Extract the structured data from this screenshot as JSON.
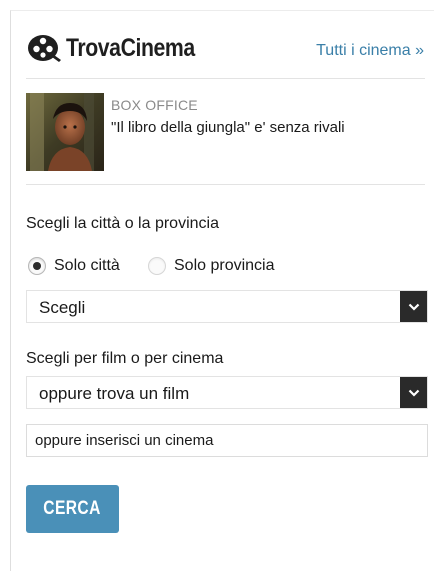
{
  "header": {
    "logo_text": "TrovaCinema",
    "all_cinemas_link": "Tutti i cinema »"
  },
  "news": {
    "kicker": "BOX OFFICE",
    "title": "\"Il libro della giungla\" e' senza rivali"
  },
  "form": {
    "city_label": "Scegli la città o la provincia",
    "radio_city_label": "Solo città",
    "radio_province_label": "Solo provincia",
    "radio_selected": "city",
    "city_select_value": "Scegli",
    "film_label": "Scegli per film o per cinema",
    "film_select_value": "oppure trova un film",
    "cinema_input_placeholder": "oppure inserisci un cinema",
    "submit_label": "CERCA"
  },
  "colors": {
    "accent": "#4a90b8",
    "link": "#3a7fa8",
    "chevron_bg": "#2a2a2a"
  },
  "icons": {
    "logo": "film-reel-icon",
    "select_arrow": "chevron-down-icon"
  }
}
